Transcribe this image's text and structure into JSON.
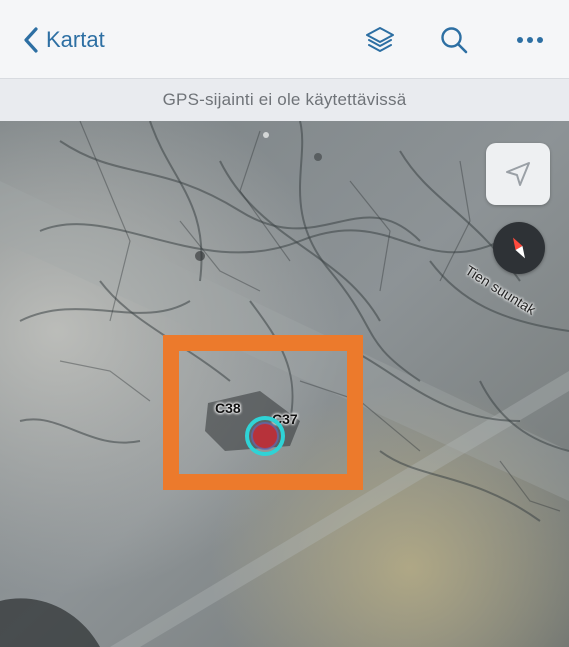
{
  "navbar": {
    "back_label": "Kartat",
    "icons": [
      "chevron-left-icon",
      "layers-icon",
      "search-icon",
      "more-icon"
    ],
    "accent_color": "#2d6fa3"
  },
  "banner": {
    "text": "GPS-sijainti ei ole käytettävissä"
  },
  "map": {
    "road_label": "Tien suuntak",
    "points": [
      {
        "label": "C38"
      },
      {
        "label": "C37"
      }
    ],
    "highlight_color": "#ec7a2c",
    "marker_ring_color": "#2fd3d6",
    "marker_fill_color": "#b7323a",
    "compass_icon": "compass-icon",
    "locate_icon": "location-arrow-icon"
  }
}
